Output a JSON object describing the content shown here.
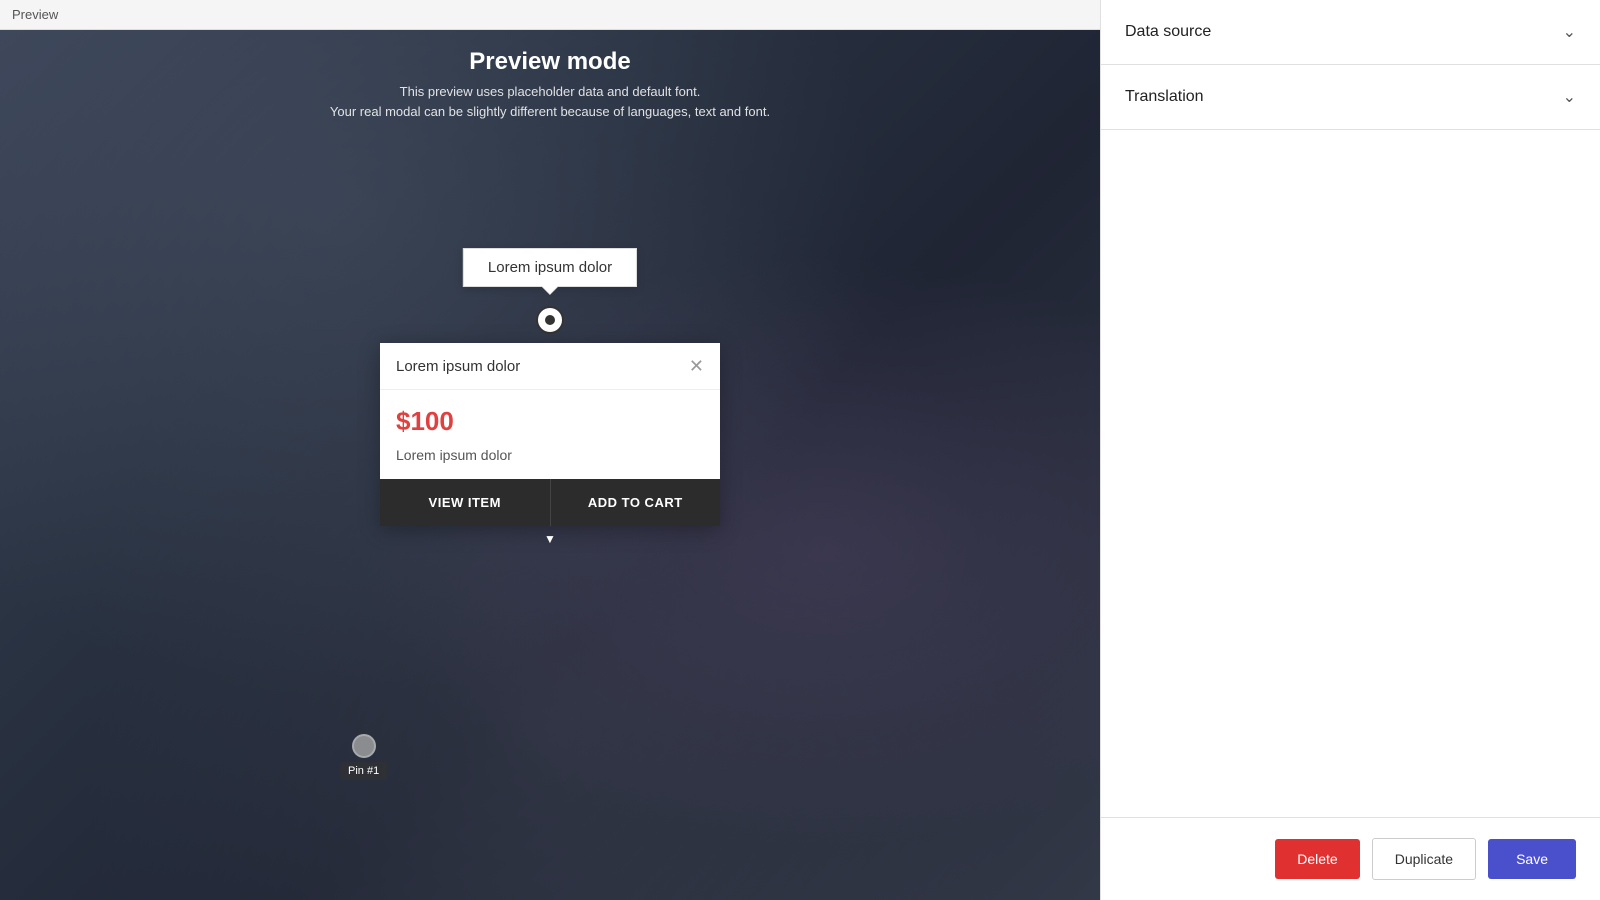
{
  "topbar": {
    "label": "Preview"
  },
  "preview_header": {
    "title": "Preview mode",
    "line1": "This preview uses placeholder data and default font.",
    "line2": "Your real modal can be slightly different because of languages, text and font."
  },
  "tooltip": {
    "text": "Lorem ipsum dolor"
  },
  "modal": {
    "title": "Lorem ipsum dolor",
    "price": "$100",
    "description": "Lorem ipsum dolor",
    "view_item_label": "VIEW ITEM",
    "add_to_cart_label": "ADD TO CART"
  },
  "pin_secondary": {
    "label": "Pin #1"
  },
  "sidebar": {
    "data_source_label": "Data source",
    "translation_label": "Translation",
    "delete_label": "Delete",
    "duplicate_label": "Duplicate",
    "save_label": "Save"
  }
}
